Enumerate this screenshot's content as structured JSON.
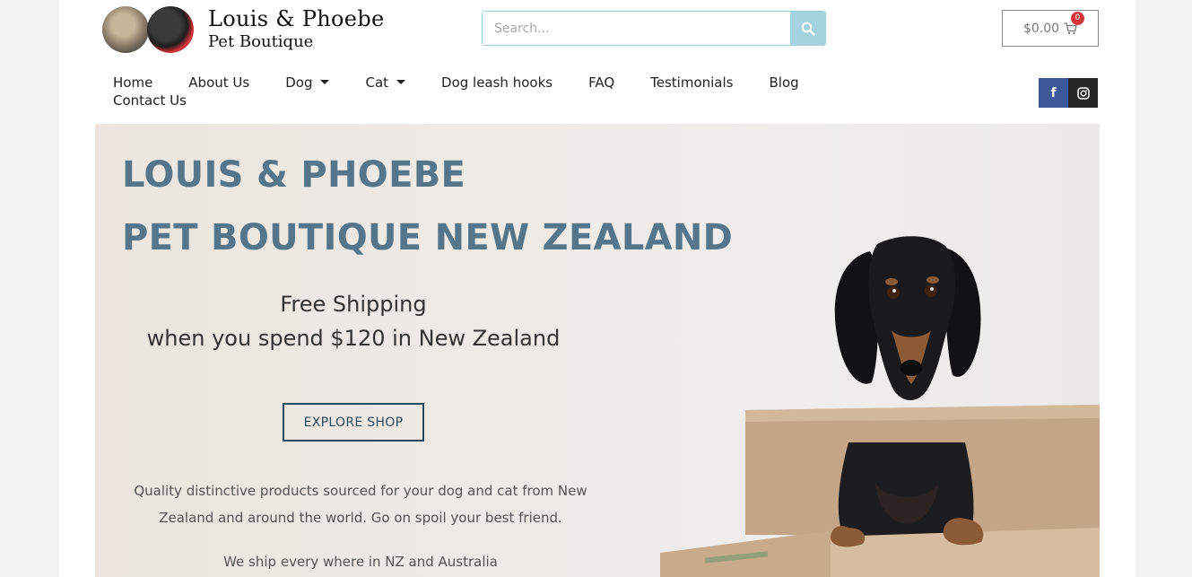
{
  "header": {
    "logo_title": "Louis & Phoebe",
    "logo_subtitle": "Pet Boutique",
    "search_placeholder": "Search...",
    "cart_total": "$0.00",
    "cart_count": "0"
  },
  "nav": {
    "items": [
      {
        "label": "Home",
        "has_dropdown": false
      },
      {
        "label": "About Us",
        "has_dropdown": false
      },
      {
        "label": "Dog",
        "has_dropdown": true
      },
      {
        "label": "Cat",
        "has_dropdown": true
      },
      {
        "label": "Dog leash hooks",
        "has_dropdown": false
      },
      {
        "label": "FAQ",
        "has_dropdown": false
      },
      {
        "label": "Testimonials",
        "has_dropdown": false
      },
      {
        "label": "Blog",
        "has_dropdown": false
      },
      {
        "label": "Contact Us",
        "has_dropdown": false
      }
    ]
  },
  "social": {
    "facebook_icon": "facebook-icon",
    "instagram_icon": "instagram-icon",
    "facebook_letter": "f"
  },
  "hero": {
    "title_line1": "LOUIS & PHOEBE",
    "title_line2": "PET BOUTIQUE NEW ZEALAND",
    "shipping_line1": "Free Shipping",
    "shipping_line2": "when you spend $120 in New Zealand",
    "cta_label": "EXPLORE SHOP",
    "description": "Quality distinctive products sourced for your dog and cat from New Zealand and around the world.  Go on spoil your best friend.",
    "shipping_regions": "We ship every where in NZ and Australia"
  },
  "colors": {
    "title": "#55768a",
    "search_button": "#a4d3df",
    "badge": "#d6363b",
    "facebook": "#3b5998",
    "instagram": "#262626",
    "cta_border": "#2d4a5a"
  }
}
